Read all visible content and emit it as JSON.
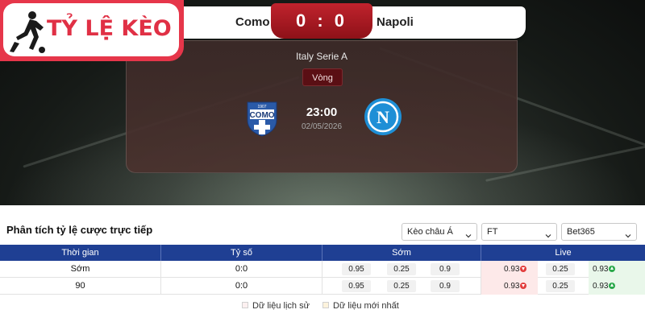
{
  "brand": {
    "text": "TỶ LỆ KÈO"
  },
  "match": {
    "home_team": "Como",
    "away_team": "Napoli",
    "score": "0 : 0",
    "league": "Italy Serie A",
    "round_label": "Vòng",
    "kickoff_time": "23:00",
    "kickoff_date": "02/05/2026",
    "home_logo_text": "COMO",
    "home_logo_year": "1907",
    "away_logo_letter": "N"
  },
  "analysis": {
    "title": "Phân tích tỷ lệ cược trực tiếp",
    "filters": [
      {
        "value": "Kèo châu Á"
      },
      {
        "value": "FT"
      },
      {
        "value": "Bet365"
      }
    ],
    "columns": [
      "Thời gian",
      "Tỷ số",
      "Sớm",
      "Live"
    ],
    "rows": [
      {
        "time": "Sớm",
        "score": "0:0",
        "early": [
          "0.95",
          "0.25",
          "0.9"
        ],
        "live": [
          "0.93",
          "0.25",
          "0.93"
        ]
      },
      {
        "time": "90",
        "score": "0:0",
        "early": [
          "0.95",
          "0.25",
          "0.9"
        ],
        "live": [
          "0.93",
          "0.25",
          "0.93"
        ]
      }
    ],
    "legend": [
      "Dữ liệu lịch sử",
      "Dữ liệu mới nhất"
    ]
  },
  "colors": {
    "brand_red": "#e03045",
    "score_red": "#a9161f",
    "table_header_blue": "#1f3f93",
    "live_down": "#e23b3b",
    "live_up": "#2aa84a"
  },
  "icons": [
    "player-silhouette-icon",
    "como-crest-icon",
    "napoli-crest-icon",
    "chevron-down-icon",
    "odds-down-icon",
    "odds-up-icon"
  ]
}
